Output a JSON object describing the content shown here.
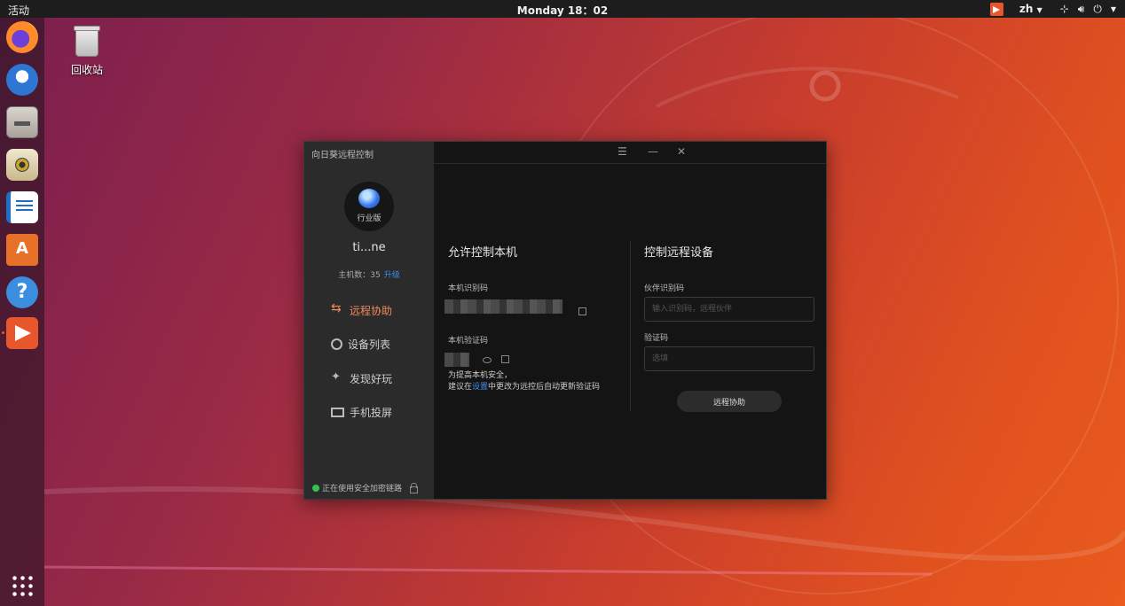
{
  "topbar": {
    "activities": "活动",
    "clock": "Monday 18：02",
    "lang": "zh"
  },
  "desktop": {
    "trash_label": "回收站"
  },
  "window": {
    "title": "向日葵远程控制",
    "controls": {
      "menu": "☰",
      "minimize": "—",
      "close": "✕"
    }
  },
  "sidebar": {
    "tier": "行业版",
    "username": "ti...ne",
    "host_count_label": "主机数：35",
    "upgrade_link": "升级",
    "nav": [
      {
        "label": "远程协助",
        "icon": "swap-arrows-icon",
        "active": true
      },
      {
        "label": "设备列表",
        "icon": "devices-icon",
        "active": false
      },
      {
        "label": "发现好玩",
        "icon": "discover-icon",
        "active": false
      },
      {
        "label": "手机投屏",
        "icon": "screen-cast-icon",
        "active": false
      }
    ],
    "secure_status": "正在使用安全加密链路",
    "status_color": "#33c24d"
  },
  "allow": {
    "title": "允许控制本机",
    "id_label": "本机识别码",
    "code_label": "本机验证码",
    "note_line1": "为提高本机安全，",
    "note_line2_pre": "建议在",
    "note_link": "设置",
    "note_line2_post": "中更改为远控后自动更新验证码"
  },
  "control": {
    "title": "控制远程设备",
    "partner_label": "伙伴识别码",
    "partner_placeholder": "输入识别码，远程伙伴",
    "verify_label": "验证码",
    "verify_placeholder": "选填",
    "connect_button": "远程协助"
  },
  "colors": {
    "accent": "#f08a5d",
    "link": "#3b8eea",
    "brand": "#e8572b"
  }
}
